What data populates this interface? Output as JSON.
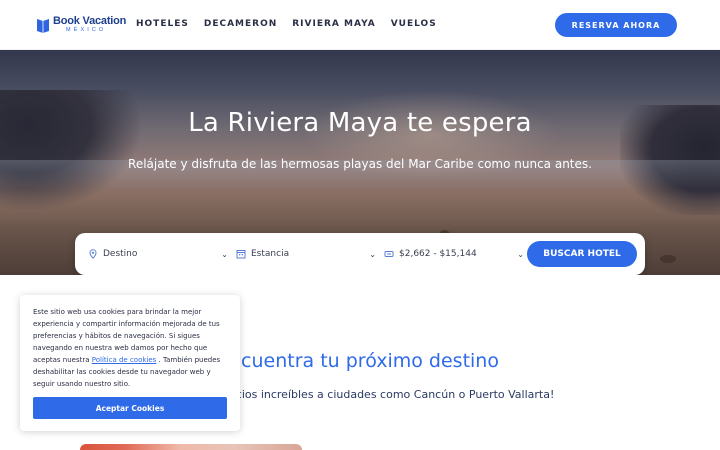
{
  "brand": {
    "name": "Book Vacation",
    "sub": "MÉXICO",
    "color": "#1d3f8f"
  },
  "nav": {
    "items": [
      "HOTELES",
      "DECAMERON",
      "RIVIERA MAYA",
      "VUELOS"
    ]
  },
  "header": {
    "cta_label": "RESERVA AHORA"
  },
  "hero": {
    "title": "La Riviera Maya te espera",
    "subtitle": "Relájate y disfruta de las hermosas playas del Mar Caribe como nunca antes."
  },
  "search": {
    "destination": "Destino",
    "stay": "Estancia",
    "price": "$2,662 - $15,144",
    "button": "BUSCAR HOTEL"
  },
  "section": {
    "title": "ncuentra tu próximo destino",
    "subtitle": "ecios increíbles a ciudades como Cancún o Puerto Vallarta!"
  },
  "cookie": {
    "text_before": "Este sitio web usa cookies para brindar la mejor experiencia y compartir información mejorada de tus preferencias y hábitos de navegación. Si sigues navegando en nuestra web damos por hecho que aceptas nuestra ",
    "link": "Política de cookies",
    "text_after": " . También puedes deshabilitar las cookies desde tu navegador web y seguir usando nuestro sitio.",
    "button": "Aceptar Cookies"
  },
  "colors": {
    "accent": "#2f6ae8",
    "text_dark": "#2a2f45"
  },
  "icons": [
    "location-pin-icon",
    "calendar-icon",
    "price-tag-icon",
    "chevron-down-icon"
  ]
}
